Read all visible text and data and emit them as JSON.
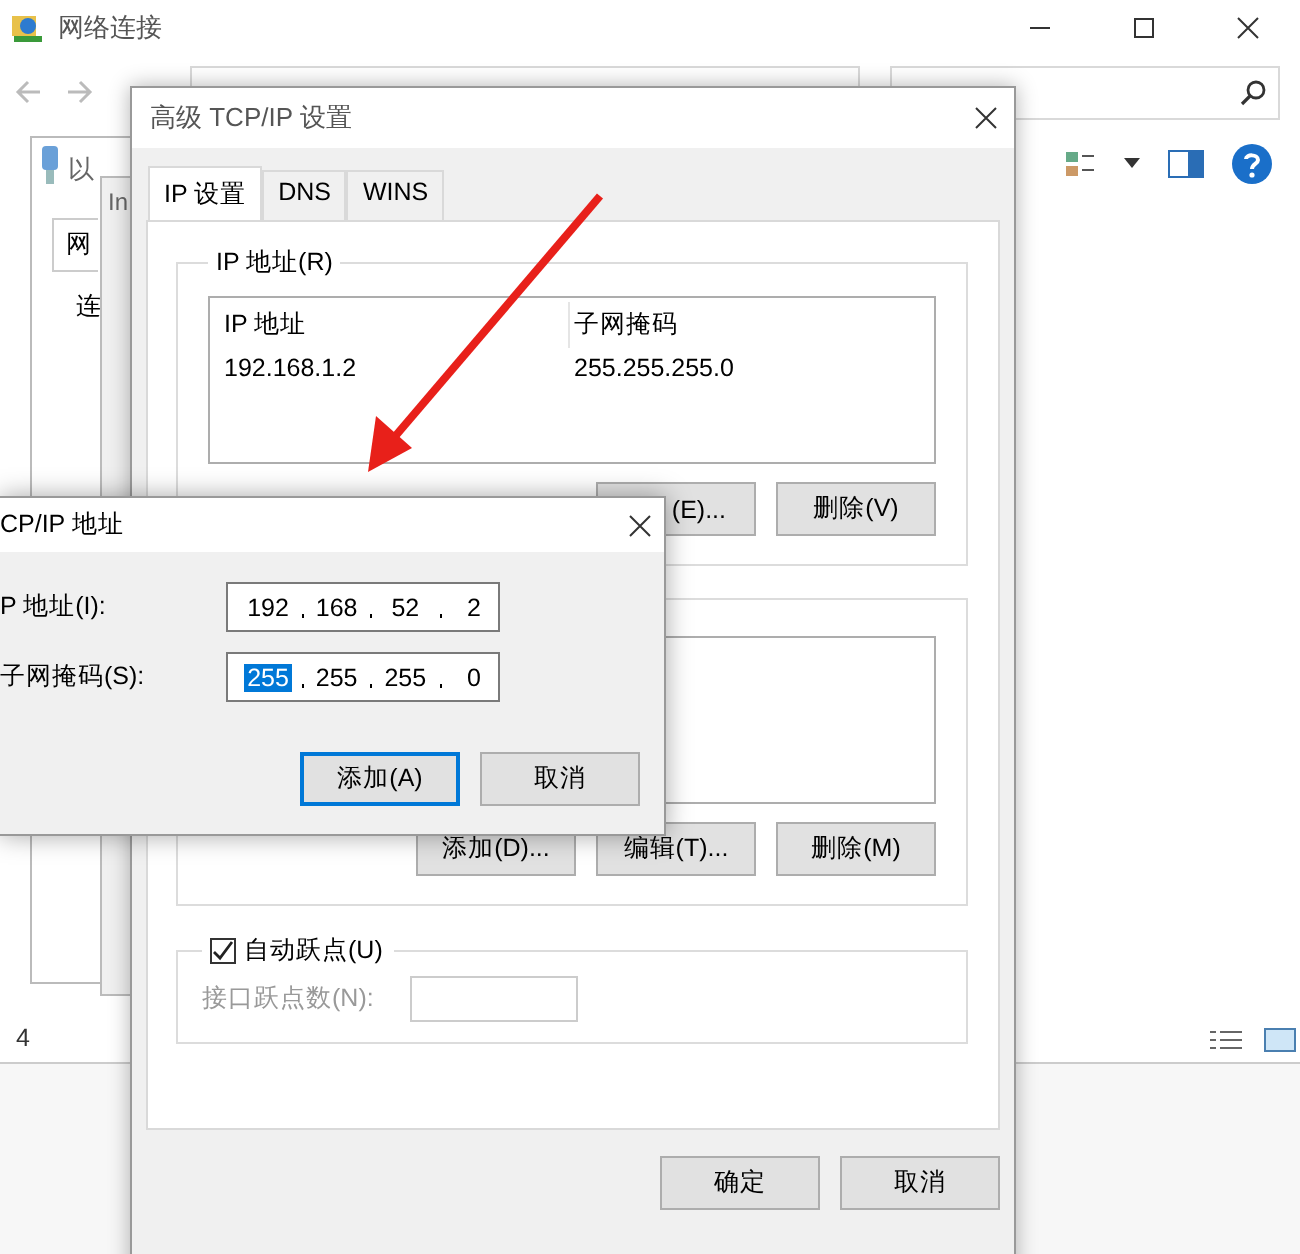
{
  "explorer": {
    "title": "网络连接",
    "status_count": "4"
  },
  "background_windows": [
    {
      "title": "以"
    },
    {
      "title": "In"
    }
  ],
  "background_tab": "网",
  "background_label": "连",
  "advanced_dialog": {
    "title": "高级 TCP/IP 设置",
    "tabs": [
      {
        "label": "IP 设置",
        "selected": true
      },
      {
        "label": "DNS",
        "selected": false
      },
      {
        "label": "WINS",
        "selected": false
      }
    ],
    "ip_group": {
      "label": "IP 地址(R)",
      "columns": [
        "IP 地址",
        "子网掩码"
      ],
      "rows": [
        [
          "192.168.1.2",
          "255.255.255.0"
        ]
      ],
      "buttons": [
        "(E)...",
        "删除(V)"
      ]
    },
    "gateway_group": {
      "buttons": [
        "添加(D)...",
        "编辑(T)...",
        "删除(M)"
      ]
    },
    "auto_metric": {
      "label": "自动跃点(U)",
      "checked": true
    },
    "metric_field": {
      "label": "接口跃点数(N):",
      "disabled": true
    },
    "buttons": [
      "确定",
      "取消"
    ]
  },
  "address_dialog": {
    "title": "CP/IP 地址",
    "fields": [
      {
        "label": "P 地址(I):",
        "octets": [
          {
            "text": "192",
            "selected": false
          },
          {
            "text": "168",
            "selected": false
          },
          {
            "text": "52",
            "selected": false
          },
          {
            "text": "2",
            "selected": false
          }
        ]
      },
      {
        "label": "子网掩码(S):",
        "octets": [
          {
            "text": "255",
            "selected": true
          },
          {
            "text": "255",
            "selected": false
          },
          {
            "text": "255",
            "selected": false
          },
          {
            "text": "0",
            "selected": false
          }
        ]
      }
    ],
    "buttons": [
      {
        "label": "添加(A)",
        "default": true
      },
      {
        "label": "取消",
        "default": false
      }
    ]
  }
}
